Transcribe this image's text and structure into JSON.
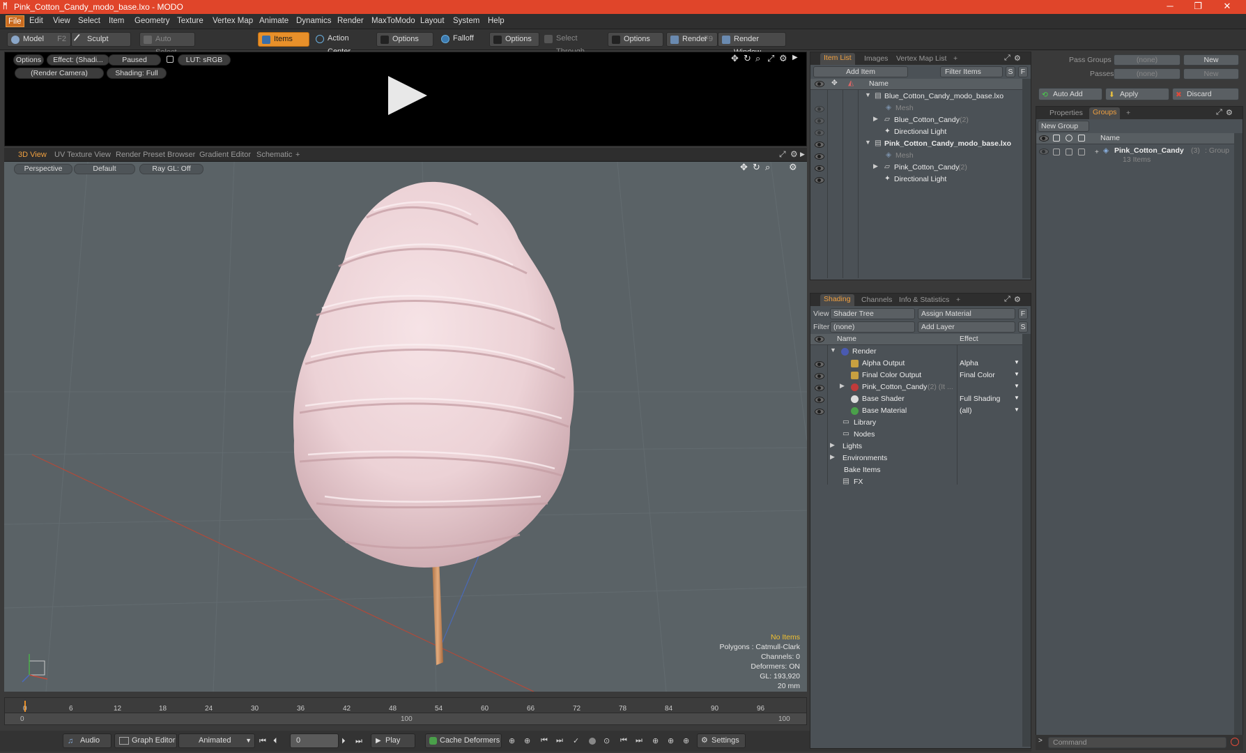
{
  "window": {
    "title": "Pink_Cotton_Candy_modo_base.lxo - MODO",
    "controls": [
      "─",
      "❐",
      "✕"
    ]
  },
  "menu": [
    "File",
    "Edit",
    "View",
    "Select",
    "Item",
    "Geometry",
    "Texture",
    "Vertex Map",
    "Animate",
    "Dynamics",
    "Render",
    "MaxToModo",
    "Layout",
    "System",
    "Help"
  ],
  "toolbar": {
    "model": "Model",
    "model_hotkey": "F2",
    "sculpt": "Sculpt",
    "auto_select": "Auto Select",
    "items": "Items",
    "action_center": "Action Center",
    "options1": "Options",
    "falloff": "Falloff",
    "options2": "Options",
    "select_through": "Select Through",
    "options3": "Options",
    "render": "Render",
    "render_hotkey": "F9",
    "render_window": "Render Window"
  },
  "preview": {
    "options": "Options",
    "effect": "Effect: (Shadi...",
    "paused": "Paused",
    "lut": "LUT: sRGB",
    "camera": "(Render Camera)",
    "shading": "Shading: Full"
  },
  "viewport_tabs": [
    "3D View",
    "UV Texture View",
    "Render Preset Browser",
    "Gradient Editor",
    "Schematic",
    "+"
  ],
  "viewport": {
    "perspective": "Perspective",
    "default": "Default",
    "raygl": "Ray GL: Off",
    "stats": {
      "items": "No Items",
      "polygons": "Polygons : Catmull-Clark",
      "channels": "Channels: 0",
      "deformers": "Deformers: ON",
      "gl": "GL: 193,920",
      "scale": "20 mm"
    }
  },
  "timeline": {
    "ticks": [
      "0",
      "6",
      "12",
      "18",
      "24",
      "30",
      "36",
      "42",
      "48",
      "54",
      "60",
      "66",
      "72",
      "78",
      "84",
      "90",
      "96"
    ],
    "range_start": "0",
    "range_mid": "100",
    "range_end": "100"
  },
  "bottombar": {
    "audio": "Audio",
    "graph_editor": "Graph Editor",
    "animated": "Animated",
    "frame": "0",
    "play": "Play",
    "cache_deformers": "Cache Deformers",
    "settings": "Settings"
  },
  "item_list": {
    "tabs": [
      "Item List",
      "Images",
      "Vertex Map List",
      "+"
    ],
    "add_item": "Add Item",
    "filter_items": "Filter Items",
    "s": "S",
    "f": "F",
    "name_header": "Name",
    "rows": [
      {
        "label": "Blue_Cotton_Candy_modo_base.lxo",
        "count": ""
      },
      {
        "label": "Mesh",
        "count": ""
      },
      {
        "label": "Blue_Cotton_Candy",
        "count": "(2)"
      },
      {
        "label": "Directional Light",
        "count": ""
      },
      {
        "label": "Pink_Cotton_Candy_modo_base.lxo",
        "count": ""
      },
      {
        "label": "Mesh",
        "count": ""
      },
      {
        "label": "Pink_Cotton_Candy",
        "count": "(2)"
      },
      {
        "label": "Directional Light",
        "count": ""
      }
    ]
  },
  "shading": {
    "tabs": [
      "Shading",
      "Channels",
      "Info & Statistics",
      "+"
    ],
    "view_label": "View",
    "view_value": "Shader Tree",
    "assign_material": "Assign Material",
    "f": "F",
    "filter_label": "Filter",
    "filter_value": "(none)",
    "add_layer": "Add Layer",
    "s": "S",
    "name_header": "Name",
    "effect_header": "Effect",
    "rows": [
      {
        "label": "Render",
        "effect": ""
      },
      {
        "label": "Alpha Output",
        "effect": "Alpha"
      },
      {
        "label": "Final Color Output",
        "effect": "Final Color"
      },
      {
        "label": "Pink_Cotton_Candy",
        "extra": "(2) (It ...",
        "effect": ""
      },
      {
        "label": "Base Shader",
        "effect": "Full Shading"
      },
      {
        "label": "Base Material",
        "effect": "(all)"
      },
      {
        "label": "Library",
        "effect": ""
      },
      {
        "label": "Nodes",
        "effect": ""
      },
      {
        "label": "Lights",
        "effect": ""
      },
      {
        "label": "Environments",
        "effect": ""
      },
      {
        "label": "Bake Items",
        "effect": ""
      },
      {
        "label": "FX",
        "effect": ""
      }
    ]
  },
  "groups_panel": {
    "pass_groups_label": "Pass Groups",
    "pass_groups_value": "(none)",
    "passes_label": "Passes",
    "passes_value": "(none)",
    "new1": "New",
    "new2": "New",
    "auto_add": "Auto Add",
    "apply": "Apply",
    "discard": "Discard",
    "tabs": [
      "Properties",
      "Groups",
      "+"
    ],
    "new_group": "New Group",
    "name_header": "Name",
    "group_name": "Pink_Cotton_Candy",
    "group_count": "(3)",
    "group_type": ": Group",
    "group_items": "13 Items"
  },
  "command": {
    "placeholder": "Command"
  },
  "colors": {
    "accent": "#e8902a",
    "titlebar": "#e0452a",
    "candy": "#f2d8dc",
    "stick": "#d99a6c"
  }
}
